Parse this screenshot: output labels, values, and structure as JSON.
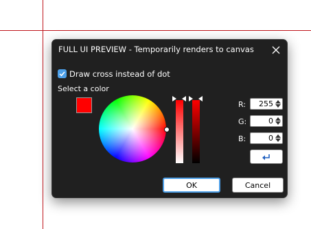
{
  "dialog": {
    "title": "FULL UI PREVIEW - Temporarily renders to canvas",
    "draw_cross_label": "Draw cross instead of dot",
    "draw_cross_checked": true,
    "select_color_label": "Select a color",
    "selected_color": "#ff0000",
    "channels": [
      {
        "label": "R:",
        "value": "255"
      },
      {
        "label": "G:",
        "value": "0"
      },
      {
        "label": "B:",
        "value": "0"
      }
    ],
    "ok_label": "OK",
    "cancel_label": "Cancel"
  },
  "icons": {
    "close": "close-icon",
    "check": "checkmark-icon",
    "reset": "undo-arrow-icon"
  },
  "colors": {
    "dialog_bg": "#202020",
    "accent": "#4c9fe8",
    "guide_line": "#c0151b"
  }
}
